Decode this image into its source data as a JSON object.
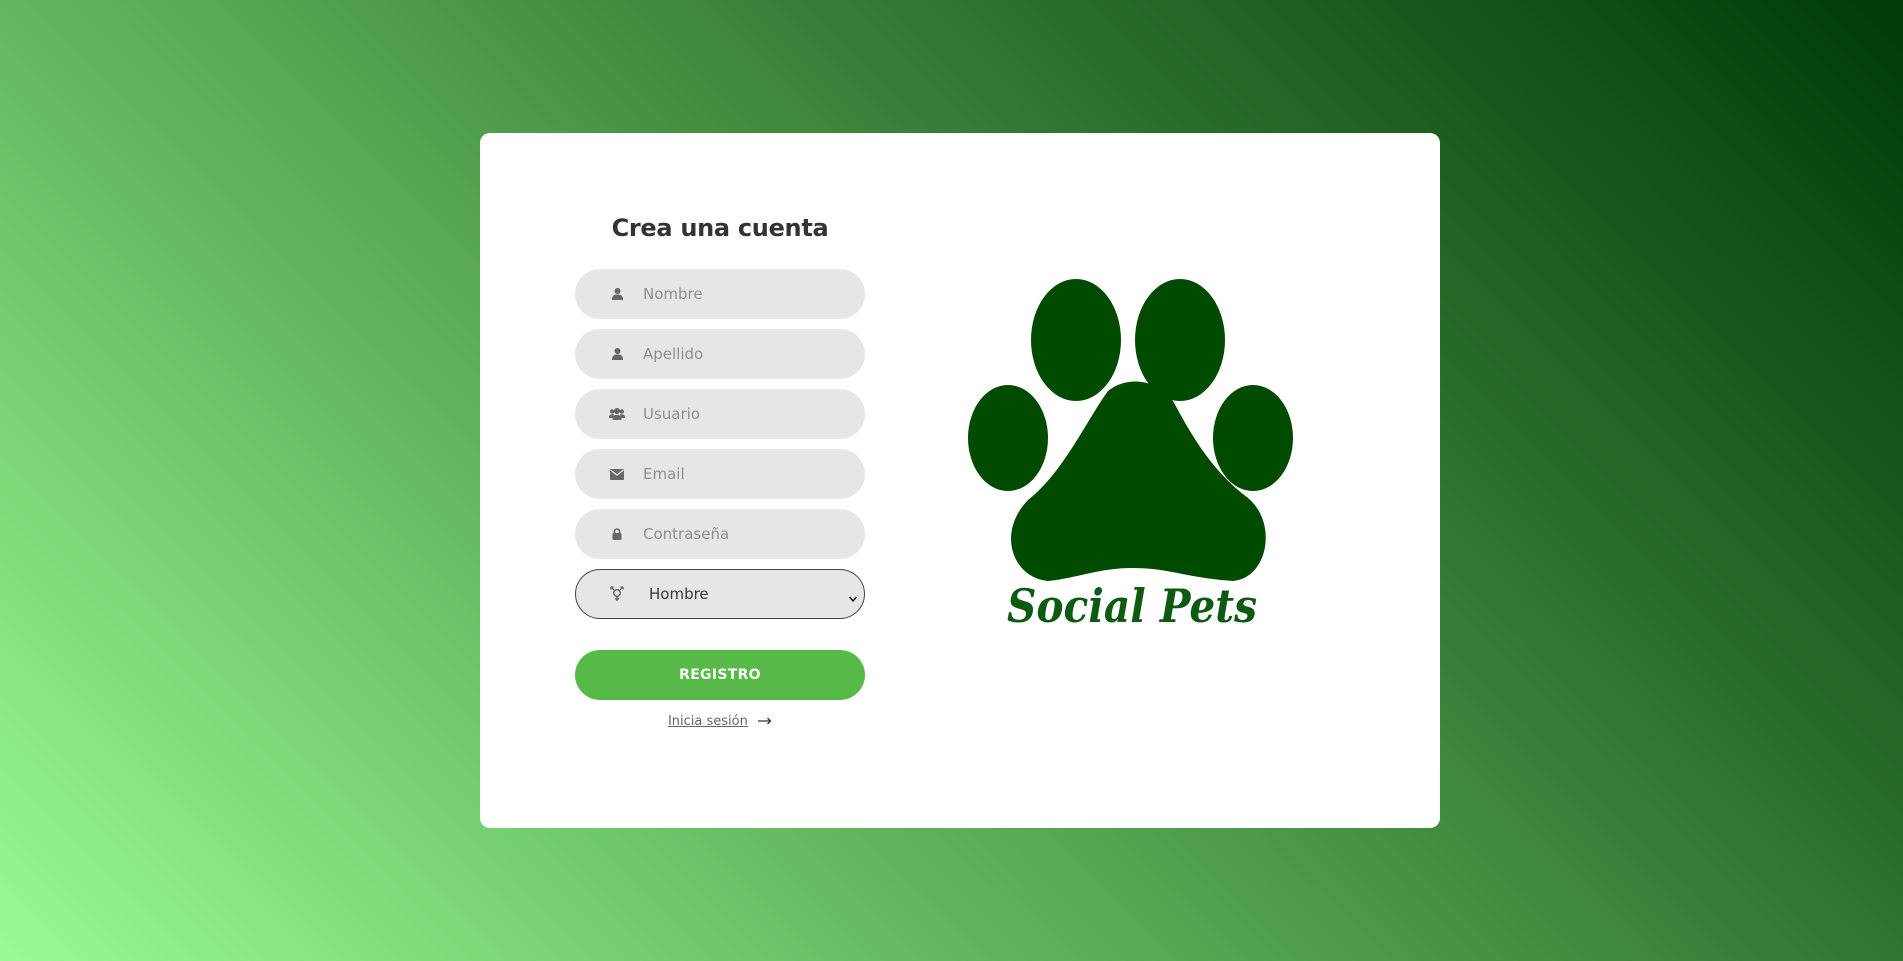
{
  "form": {
    "title": "Crea una cuenta",
    "fields": [
      {
        "name": "nombre",
        "placeholder": "Nombre",
        "icon": "user-icon"
      },
      {
        "name": "apellido",
        "placeholder": "Apellido",
        "icon": "user-icon"
      },
      {
        "name": "usuario",
        "placeholder": "Usuario",
        "icon": "users-icon"
      },
      {
        "name": "email",
        "placeholder": "Email",
        "icon": "envelope-icon"
      },
      {
        "name": "contrasena",
        "placeholder": "Contraseña",
        "icon": "lock-icon"
      }
    ],
    "gender_select": {
      "selected": "Hombre",
      "icon": "transgender-icon"
    },
    "submit_label": "REGISTRO",
    "login_link": {
      "label": "Inicia sesión",
      "icon": "arrow-right-icon"
    }
  },
  "logo": {
    "text": "Social Pets",
    "icon": "paw-icon",
    "color": "#004b00"
  },
  "colors": {
    "accent": "#57b947",
    "input_bg": "#e6e6e6",
    "gradient_dark": "#003a06",
    "gradient_light": "#98fb93"
  }
}
